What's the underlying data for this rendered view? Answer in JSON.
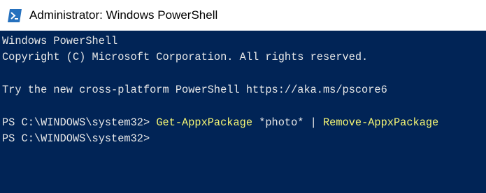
{
  "window": {
    "title": "Administrator: Windows PowerShell",
    "icon": "powershell-icon",
    "background_color": "#012456",
    "text_color": "#e8e8e8",
    "command_color": "#f7f774"
  },
  "console": {
    "header_line1": "Windows PowerShell",
    "header_line2": "Copyright (C) Microsoft Corporation. All rights reserved.",
    "header_line3": "",
    "header_line4": "Try the new cross-platform PowerShell https://aka.ms/pscore6",
    "header_line5": "",
    "prompt1": "PS C:\\WINDOWS\\system32> ",
    "cmd1_part1": "Get-AppxPackage",
    "cmd1_part2": " *photo* | ",
    "cmd1_part3": "Remove-AppxPackage",
    "prompt2": "PS C:\\WINDOWS\\system32>"
  }
}
